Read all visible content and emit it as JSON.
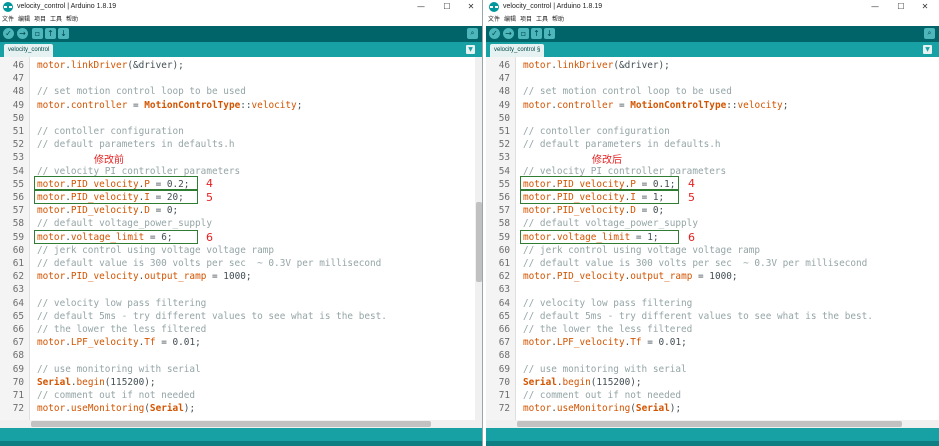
{
  "windows": [
    {
      "title": "velocity_control | Arduino 1.8.19",
      "menu": [
        "文件",
        "编辑",
        "项目",
        "工具",
        "帮助"
      ],
      "tab_label": "velocity_control",
      "controls": {
        "minimize": "—",
        "maximize": "☐",
        "close": "✕"
      },
      "annotation_label": "修改前",
      "lines": [
        {
          "n": "46",
          "tokens": [
            [
              "obj",
              "motor"
            ],
            [
              "plain",
              "."
            ],
            [
              "fn",
              "linkDriver"
            ],
            [
              "plain",
              "(&driver);"
            ]
          ]
        },
        {
          "n": "47",
          "tokens": []
        },
        {
          "n": "48",
          "tokens": [
            [
              "com",
              "// set motion control loop to be used"
            ]
          ]
        },
        {
          "n": "49",
          "tokens": [
            [
              "obj",
              "motor"
            ],
            [
              "plain",
              "."
            ],
            [
              "fn",
              "controller"
            ],
            [
              "plain",
              " = "
            ],
            [
              "kw",
              "MotionControlType"
            ],
            [
              "plain",
              "::"
            ],
            [
              "fn",
              "velocity"
            ],
            [
              "plain",
              ";"
            ]
          ]
        },
        {
          "n": "50",
          "tokens": []
        },
        {
          "n": "51",
          "tokens": [
            [
              "com",
              "// contoller configuration"
            ]
          ]
        },
        {
          "n": "52",
          "tokens": [
            [
              "com",
              "// default parameters in defaults.h"
            ]
          ]
        },
        {
          "n": "53",
          "tokens": []
        },
        {
          "n": "54",
          "tokens": [
            [
              "com",
              "// velocity PI controller parameters"
            ]
          ]
        },
        {
          "n": "55",
          "tokens": [
            [
              "obj",
              "motor"
            ],
            [
              "plain",
              "."
            ],
            [
              "fn",
              "PID_velocity"
            ],
            [
              "plain",
              "."
            ],
            [
              "fn",
              "P"
            ],
            [
              "plain",
              " = 0.2;"
            ]
          ]
        },
        {
          "n": "56",
          "tokens": [
            [
              "obj",
              "motor"
            ],
            [
              "plain",
              "."
            ],
            [
              "fn",
              "PID_velocity"
            ],
            [
              "plain",
              "."
            ],
            [
              "fn",
              "I"
            ],
            [
              "plain",
              " = 20;"
            ]
          ]
        },
        {
          "n": "57",
          "tokens": [
            [
              "obj",
              "motor"
            ],
            [
              "plain",
              "."
            ],
            [
              "fn",
              "PID_velocity"
            ],
            [
              "plain",
              "."
            ],
            [
              "fn",
              "D"
            ],
            [
              "plain",
              " = 0;"
            ]
          ]
        },
        {
          "n": "58",
          "tokens": [
            [
              "com",
              "// default voltage_power_supply"
            ]
          ]
        },
        {
          "n": "59",
          "tokens": [
            [
              "obj",
              "motor"
            ],
            [
              "plain",
              "."
            ],
            [
              "fn",
              "voltage_limit"
            ],
            [
              "plain",
              " = 6;"
            ]
          ]
        },
        {
          "n": "60",
          "tokens": [
            [
              "com",
              "// jerk control using voltage voltage ramp"
            ]
          ]
        },
        {
          "n": "61",
          "tokens": [
            [
              "com",
              "// default value is 300 volts per sec  ~ 0.3V per millisecond"
            ]
          ]
        },
        {
          "n": "62",
          "tokens": [
            [
              "obj",
              "motor"
            ],
            [
              "plain",
              "."
            ],
            [
              "fn",
              "PID_velocity"
            ],
            [
              "plain",
              "."
            ],
            [
              "fn",
              "output_ramp"
            ],
            [
              "plain",
              " = 1000;"
            ]
          ]
        },
        {
          "n": "63",
          "tokens": []
        },
        {
          "n": "64",
          "tokens": [
            [
              "com",
              "// velocity low pass filtering"
            ]
          ]
        },
        {
          "n": "65",
          "tokens": [
            [
              "com",
              "// default 5ms - try different values to see what is the best."
            ]
          ]
        },
        {
          "n": "66",
          "tokens": [
            [
              "com",
              "// the lower the less filtered"
            ]
          ]
        },
        {
          "n": "67",
          "tokens": [
            [
              "obj",
              "motor"
            ],
            [
              "plain",
              "."
            ],
            [
              "fn",
              "LPF_velocity"
            ],
            [
              "plain",
              "."
            ],
            [
              "fn",
              "Tf"
            ],
            [
              "plain",
              " = 0.01;"
            ]
          ]
        },
        {
          "n": "68",
          "tokens": []
        },
        {
          "n": "69",
          "tokens": [
            [
              "com",
              "// use monitoring with serial"
            ]
          ]
        },
        {
          "n": "70",
          "tokens": [
            [
              "kw",
              "Serial"
            ],
            [
              "plain",
              "."
            ],
            [
              "fn",
              "begin"
            ],
            [
              "plain",
              "(115200);"
            ]
          ]
        },
        {
          "n": "71",
          "tokens": [
            [
              "com",
              "// comment out if not needed"
            ]
          ]
        },
        {
          "n": "72",
          "tokens": [
            [
              "obj",
              "motor"
            ],
            [
              "plain",
              "."
            ],
            [
              "fn",
              "useMonitoring"
            ],
            [
              "plain",
              "("
            ],
            [
              "kw",
              "Serial"
            ],
            [
              "plain",
              ");"
            ]
          ]
        }
      ],
      "annotations": [
        "4",
        "5",
        "6"
      ]
    },
    {
      "title": "velocity_control | Arduino 1.8.19",
      "menu": [
        "文件",
        "编辑",
        "项目",
        "工具",
        "帮助"
      ],
      "tab_label": "velocity_control §",
      "controls": {
        "minimize": "—",
        "maximize": "☐",
        "close": "✕"
      },
      "annotation_label": "修改后",
      "lines": [
        {
          "n": "46",
          "tokens": [
            [
              "obj",
              "motor"
            ],
            [
              "plain",
              "."
            ],
            [
              "fn",
              "linkDriver"
            ],
            [
              "plain",
              "(&driver);"
            ]
          ]
        },
        {
          "n": "47",
          "tokens": []
        },
        {
          "n": "48",
          "tokens": [
            [
              "com",
              "// set motion control loop to be used"
            ]
          ]
        },
        {
          "n": "49",
          "tokens": [
            [
              "obj",
              "motor"
            ],
            [
              "plain",
              "."
            ],
            [
              "fn",
              "controller"
            ],
            [
              "plain",
              " = "
            ],
            [
              "kw",
              "MotionControlType"
            ],
            [
              "plain",
              "::"
            ],
            [
              "fn",
              "velocity"
            ],
            [
              "plain",
              ";"
            ]
          ]
        },
        {
          "n": "50",
          "tokens": []
        },
        {
          "n": "51",
          "tokens": [
            [
              "com",
              "// contoller configuration"
            ]
          ]
        },
        {
          "n": "52",
          "tokens": [
            [
              "com",
              "// default parameters in defaults.h"
            ]
          ]
        },
        {
          "n": "53",
          "tokens": []
        },
        {
          "n": "54",
          "tokens": [
            [
              "com",
              "// velocity PI controller parameters"
            ]
          ]
        },
        {
          "n": "55",
          "tokens": [
            [
              "obj",
              "motor"
            ],
            [
              "plain",
              "."
            ],
            [
              "fn",
              "PID_velocity"
            ],
            [
              "plain",
              "."
            ],
            [
              "fn",
              "P"
            ],
            [
              "plain",
              " = 0.1;"
            ]
          ]
        },
        {
          "n": "56",
          "tokens": [
            [
              "obj",
              "motor"
            ],
            [
              "plain",
              "."
            ],
            [
              "fn",
              "PID_velocity"
            ],
            [
              "plain",
              "."
            ],
            [
              "fn",
              "I"
            ],
            [
              "plain",
              " = 1;"
            ]
          ]
        },
        {
          "n": "57",
          "tokens": [
            [
              "obj",
              "motor"
            ],
            [
              "plain",
              "."
            ],
            [
              "fn",
              "PID_velocity"
            ],
            [
              "plain",
              "."
            ],
            [
              "fn",
              "D"
            ],
            [
              "plain",
              " = 0;"
            ]
          ]
        },
        {
          "n": "58",
          "tokens": [
            [
              "com",
              "// default voltage_power_supply"
            ]
          ]
        },
        {
          "n": "59",
          "tokens": [
            [
              "obj",
              "motor"
            ],
            [
              "plain",
              "."
            ],
            [
              "fn",
              "voltage_limit"
            ],
            [
              "plain",
              " = 1;"
            ]
          ]
        },
        {
          "n": "60",
          "tokens": [
            [
              "com",
              "// jerk control using voltage voltage ramp"
            ]
          ]
        },
        {
          "n": "61",
          "tokens": [
            [
              "com",
              "// default value is 300 volts per sec  ~ 0.3V per millisecond"
            ]
          ]
        },
        {
          "n": "62",
          "tokens": [
            [
              "obj",
              "motor"
            ],
            [
              "plain",
              "."
            ],
            [
              "fn",
              "PID_velocity"
            ],
            [
              "plain",
              "."
            ],
            [
              "fn",
              "output_ramp"
            ],
            [
              "plain",
              " = 1000;"
            ]
          ]
        },
        {
          "n": "63",
          "tokens": []
        },
        {
          "n": "64",
          "tokens": [
            [
              "com",
              "// velocity low pass filtering"
            ]
          ]
        },
        {
          "n": "65",
          "tokens": [
            [
              "com",
              "// default 5ms - try different values to see what is the best."
            ]
          ]
        },
        {
          "n": "66",
          "tokens": [
            [
              "com",
              "// the lower the less filtered"
            ]
          ]
        },
        {
          "n": "67",
          "tokens": [
            [
              "obj",
              "motor"
            ],
            [
              "plain",
              "."
            ],
            [
              "fn",
              "LPF_velocity"
            ],
            [
              "plain",
              "."
            ],
            [
              "fn",
              "Tf"
            ],
            [
              "plain",
              " = 0.01;"
            ]
          ]
        },
        {
          "n": "68",
          "tokens": []
        },
        {
          "n": "69",
          "tokens": [
            [
              "com",
              "// use monitoring with serial"
            ]
          ]
        },
        {
          "n": "70",
          "tokens": [
            [
              "kw",
              "Serial"
            ],
            [
              "plain",
              "."
            ],
            [
              "fn",
              "begin"
            ],
            [
              "plain",
              "(115200);"
            ]
          ]
        },
        {
          "n": "71",
          "tokens": [
            [
              "com",
              "// comment out if not needed"
            ]
          ]
        },
        {
          "n": "72",
          "tokens": [
            [
              "obj",
              "motor"
            ],
            [
              "plain",
              "."
            ],
            [
              "fn",
              "useMonitoring"
            ],
            [
              "plain",
              "("
            ],
            [
              "kw",
              "Serial"
            ],
            [
              "plain",
              ");"
            ]
          ]
        }
      ],
      "annotations": [
        "4",
        "5",
        "6"
      ]
    }
  ],
  "toolbar_icons": [
    "verify-icon",
    "upload-icon",
    "new-icon",
    "open-icon",
    "save-icon",
    "serial-monitor-icon"
  ],
  "colors": {
    "toolbar": "#006468",
    "tabbar": "#17a1a5",
    "keyword_orange": "#d35400",
    "comment_gray": "#95a5a6",
    "annotation_red": "#e51f1f",
    "highlight_green": "#2e7d32"
  }
}
